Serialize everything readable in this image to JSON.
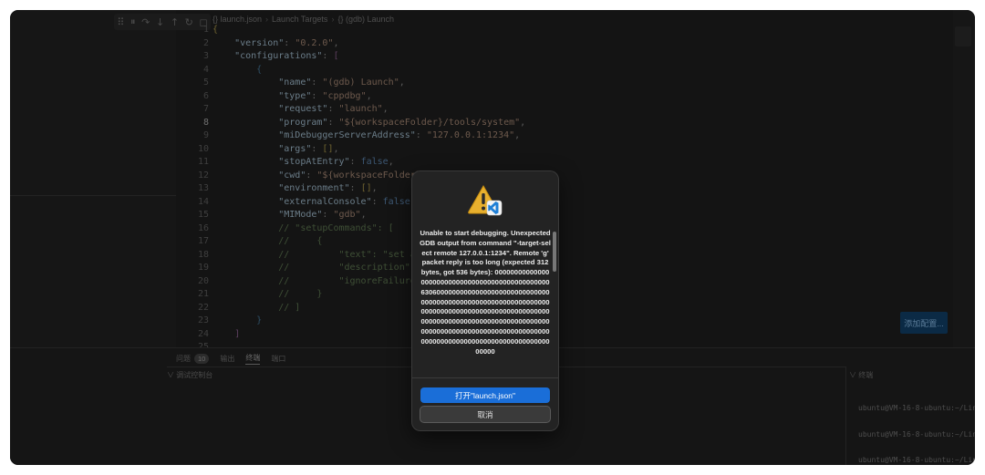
{
  "toolbar": {
    "icons": [
      "grip-icon",
      "pause-icon",
      "step-over-icon",
      "step-into-icon",
      "step-out-icon",
      "restart-icon",
      "stop-icon"
    ],
    "glyphs": [
      "⠿",
      "⏸",
      "↷",
      "↓",
      "↑",
      "↻",
      "◻"
    ]
  },
  "breadcrumb": {
    "file": "{} launch.json",
    "section": "Launch Targets",
    "item": "{} (gdb) Launch"
  },
  "editor": {
    "line_numbers": [
      "1",
      "2",
      "3",
      "4",
      "5",
      "6",
      "7",
      "8",
      "9",
      "10",
      "11",
      "12",
      "13",
      "14",
      "15",
      "16",
      "17",
      "18",
      "19",
      "20",
      "21",
      "22",
      "23",
      "24",
      "25"
    ],
    "active_line": 8
  },
  "add_config_label": "添加配置...",
  "panel": {
    "tab_problems": "问题",
    "problems_count": "10",
    "tab_output": "输出",
    "tab_terminal": "终端",
    "tab_ports": "端口",
    "debug_console": "∨ 调试控制台",
    "terminal": "∨ 终端",
    "terminal_lines": [
      "ubuntu@VM-16-8-ubuntu:~/Linu",
      "ubuntu@VM-16-8-ubuntu:~/Linu",
      "ubuntu@VM-16-8-ubuntu:~/Linu"
    ]
  },
  "dialog": {
    "message": "Unable to start debugging. Unexpected GDB output from command \"-target-select remote 127.0.0.1:1234\". Remote 'g' packet reply is too long (expected 312 bytes, got 536 bytes): 0000000000000000000000000000000000000000000000063060000000000000000000000000000000000000000000000000000000000000000000000000000000000000000000000000000000000000000000000000000000000000000000000000000000000000000000000000000000000000000000000000000000",
    "primary_button": "打开\"launch.json\"",
    "cancel_button": "取消"
  },
  "colors": {
    "accent": "#1a6ed8",
    "background": "#141414",
    "dialog": "#232323"
  }
}
